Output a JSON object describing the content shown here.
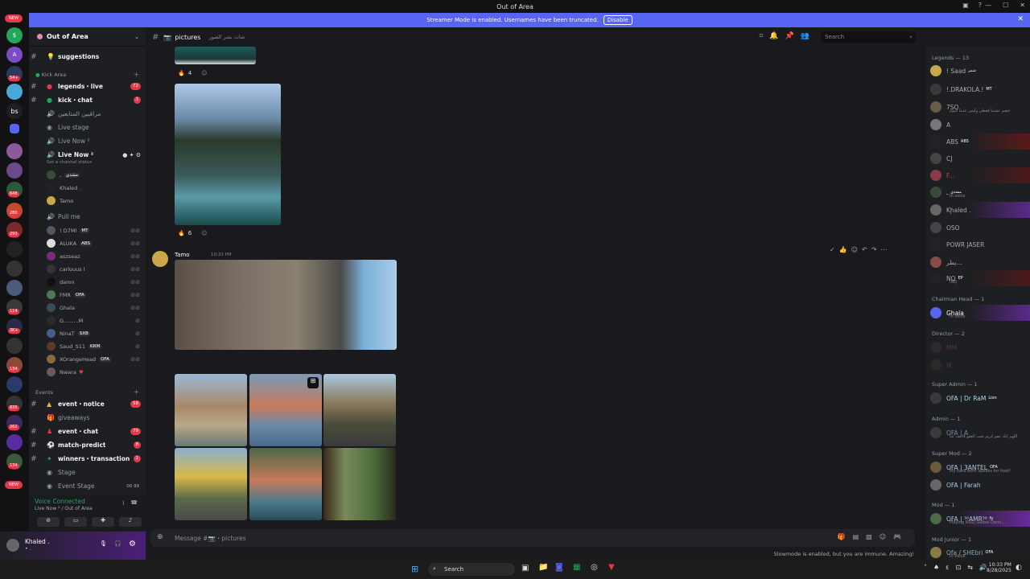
{
  "window": {
    "title": "Out of Area"
  },
  "banner": {
    "text": "Streamer Mode is enabled. Usernames have been truncated.",
    "button": "Disable"
  },
  "rail": {
    "new_top": "NEW",
    "dm": "bs",
    "badges": [
      "54+",
      "648",
      "280",
      "293",
      "114",
      "3K+",
      "134",
      "835",
      "262",
      "134"
    ],
    "new_bottom": "NEW"
  },
  "server": {
    "name": "Out of Area"
  },
  "channels": {
    "suggestions": "suggestions",
    "kick_cat": "Kick Area",
    "legends_live": "legends・live",
    "legends_live_count": "72",
    "kick_chat": "kick・chat",
    "kick_chat_count": "1",
    "arabic_channel": "مراقبين المتابعين",
    "live_stage": "Live stage",
    "live_now_1": "Live Now ²",
    "live_now_2": "Live Now ²",
    "set_status": "Set a channel status",
    "pull_me": "Pull me",
    "events_cat": "Events",
    "event_notice": "event・notice",
    "event_notice_count": "58",
    "giveaways": "giveaways",
    "event_chat": "event・chat",
    "event_chat_count": "79",
    "match_predict": "match-predict",
    "match_predict_count": "8",
    "winners": "winners・transaction",
    "winners_count": "1",
    "stage": "Stage",
    "event_stage": "Event Stage",
    "event_stage_counts": "00 99"
  },
  "voice_users_1": [
    {
      "name": "ـ",
      "tag": "مشدي"
    },
    {
      "name": "Khaled .",
      "tag": ""
    },
    {
      "name": "Tamo",
      "tag": ""
    }
  ],
  "voice_users_2": [
    {
      "name": "! D7MI",
      "tag": "MT"
    },
    {
      "name": "ALUKA",
      "tag": "ABS"
    },
    {
      "name": "aszseaz",
      "tag": ""
    },
    {
      "name": "carlouus l",
      "tag": ""
    },
    {
      "name": "damn",
      "tag": ""
    },
    {
      "name": "FMR",
      "tag": "OFA"
    },
    {
      "name": "Ghala",
      "tag": ""
    },
    {
      "name": "G.........M",
      "tag": ""
    },
    {
      "name": "NinaT",
      "tag": "SXB"
    },
    {
      "name": "Saud_S11",
      "tag": "KRM"
    },
    {
      "name": "XOrangeHead",
      "tag": "OFA"
    },
    {
      "name": "Nwara",
      "tag": ""
    }
  ],
  "voice_connected": {
    "title": "Voice Connected",
    "sub": "Live Now ² / Out of Area"
  },
  "user": {
    "name": "Khaled .",
    "status": "• ."
  },
  "channel": {
    "name": "pictures",
    "topic": "شات نشر الصور",
    "search": "Search"
  },
  "messages": {
    "react1": "4",
    "react2": "6",
    "author": "Tamo",
    "time": "10:33 PM"
  },
  "composer": {
    "placeholder": "Message #📷・pictures"
  },
  "slowmode": "Slowmode is enabled, but you are immune. Amazing!",
  "members": {
    "legends_cat": "Legends — 13",
    "legends": [
      {
        "name": "! Saad",
        "tag": "شمر",
        "status": ""
      },
      {
        "name": "!.DRAKOLA.!",
        "tag": "MT",
        "status": ""
      },
      {
        "name": "7SO",
        "tag": "",
        "status": "خصم عشما فقطي وليس عدما اليوم"
      },
      {
        "name": "A",
        "tag": "",
        "status": ""
      },
      {
        "name": "ABS",
        "tag": "ABS",
        "status": ""
      },
      {
        "name": "CJ",
        "tag": "",
        "status": ""
      },
      {
        "name": "F...",
        "tag": "",
        "status": ""
      },
      {
        "name": "ـ",
        "tag": "مشدي",
        "status": "In voice"
      },
      {
        "name": "Khaled .",
        "tag": "",
        "status": "• ."
      },
      {
        "name": "OSO",
        "tag": "",
        "status": ""
      },
      {
        "name": "POWR JASER",
        "tag": "",
        "status": ""
      },
      {
        "name": "يطر...",
        "tag": "",
        "status": ""
      },
      {
        "name": "NQ",
        "tag": "EP",
        "status": "INQ"
      }
    ],
    "chairman_cat": "Chairman Head — 1",
    "chairman": [
      {
        "name": "Ghala",
        "status": "In voice"
      }
    ],
    "director_cat": "Director — 2",
    "director": [
      {
        "name": "MM",
        "status": ""
      },
      {
        "name": "III",
        "status": ""
      }
    ],
    "superadmin_cat": "Super Admin — 1",
    "superadmin": [
      {
        "name": "OFA | Dr RaM",
        "tag": "Lion"
      }
    ],
    "admin_cat": "Admin — 1",
    "admin": [
      {
        "name": "OFA | A",
        "status": "اللهم انك عفو كريم تحب العفو فاعف عنا"
      }
    ],
    "supermod_cat": "Super Mod — 2",
    "supermod": [
      {
        "name": "OFA | 3ANTEL",
        "tag": "OFA",
        "status": "My hard work speaks for itself"
      },
      {
        "name": "OFA | Farah",
        "status": ""
      }
    ],
    "mod_cat": "Mod — 1",
    "mod": [
      {
        "name": "OFA | ³⁶AMR³⁶",
        "tag": "fy",
        "status": "Playing RSG| Global Domi..."
      }
    ],
    "modjr_cat": "Mod Junior — 1",
    "modjr": [
      {
        "name": "Ofa / SHEbri",
        "tag": "OFA",
        "status": "In voice"
      }
    ]
  },
  "taskbar": {
    "search": "Search",
    "time": "10:33 PM",
    "date": "8/28/2025"
  }
}
